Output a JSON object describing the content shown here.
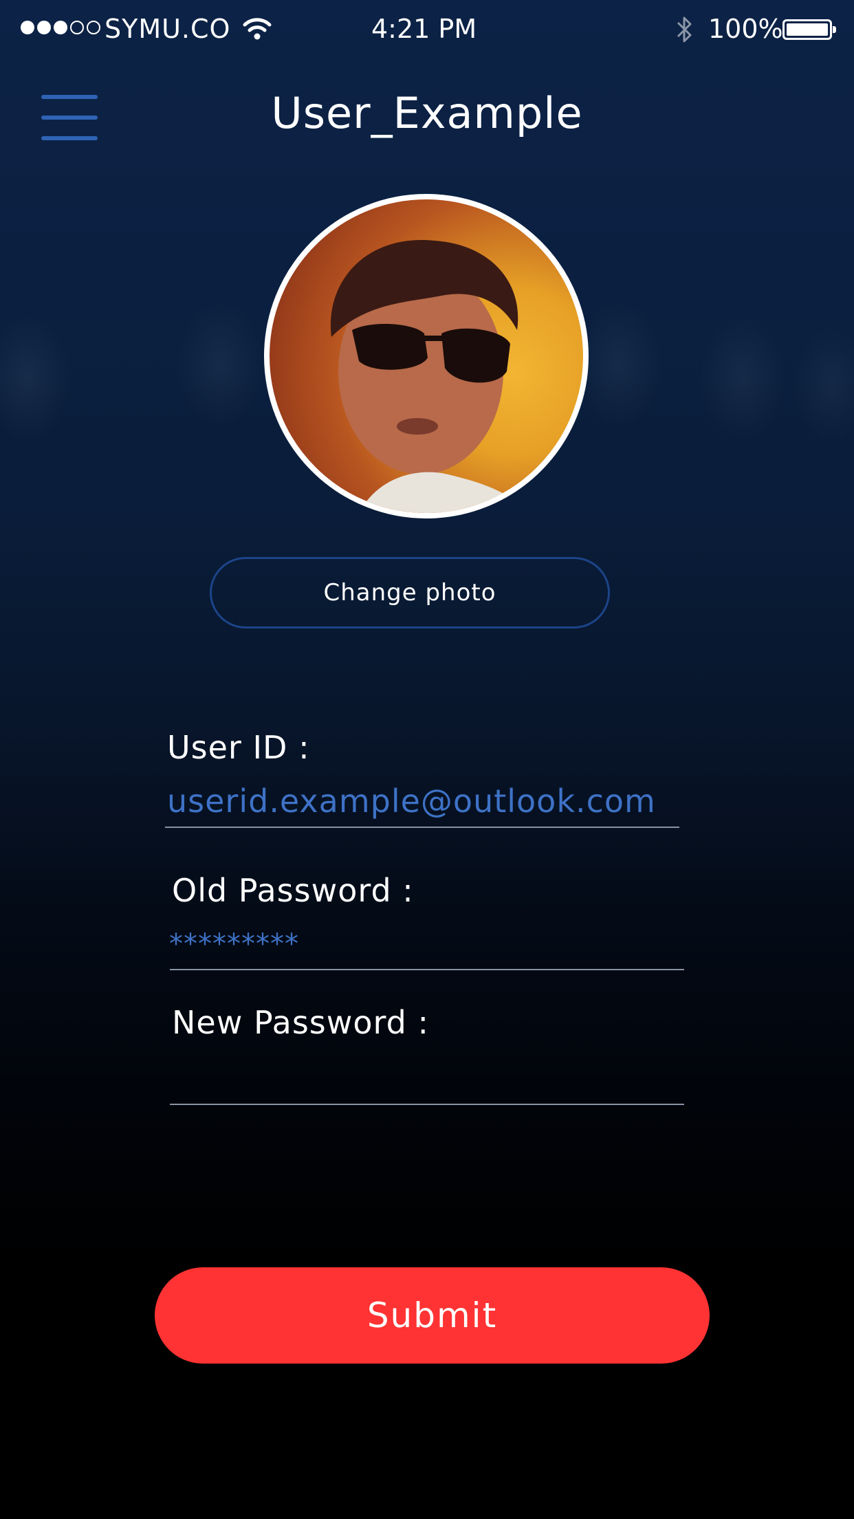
{
  "status_bar": {
    "carrier": "SYMU.CO",
    "time": "4:21 PM",
    "battery_percent": "100%",
    "signal_bars_filled": 3,
    "signal_bars_total": 5
  },
  "header": {
    "title": "User_Example",
    "menu_icon": "hamburger-menu-icon"
  },
  "profile": {
    "avatar_icon": "user-photo",
    "change_photo_label": "Change photo"
  },
  "form": {
    "user_id_label": "User ID :",
    "user_id_value": "userid.example@outlook.com",
    "old_password_label": "Old Password :",
    "old_password_value": "*********",
    "new_password_label": "New Password :",
    "new_password_value": ""
  },
  "actions": {
    "submit_label": "Submit"
  },
  "colors": {
    "accent_blue": "#3e72c6",
    "menu_blue": "#2f63b5",
    "submit_red": "#ff3333",
    "button_border": "#1c4488"
  }
}
